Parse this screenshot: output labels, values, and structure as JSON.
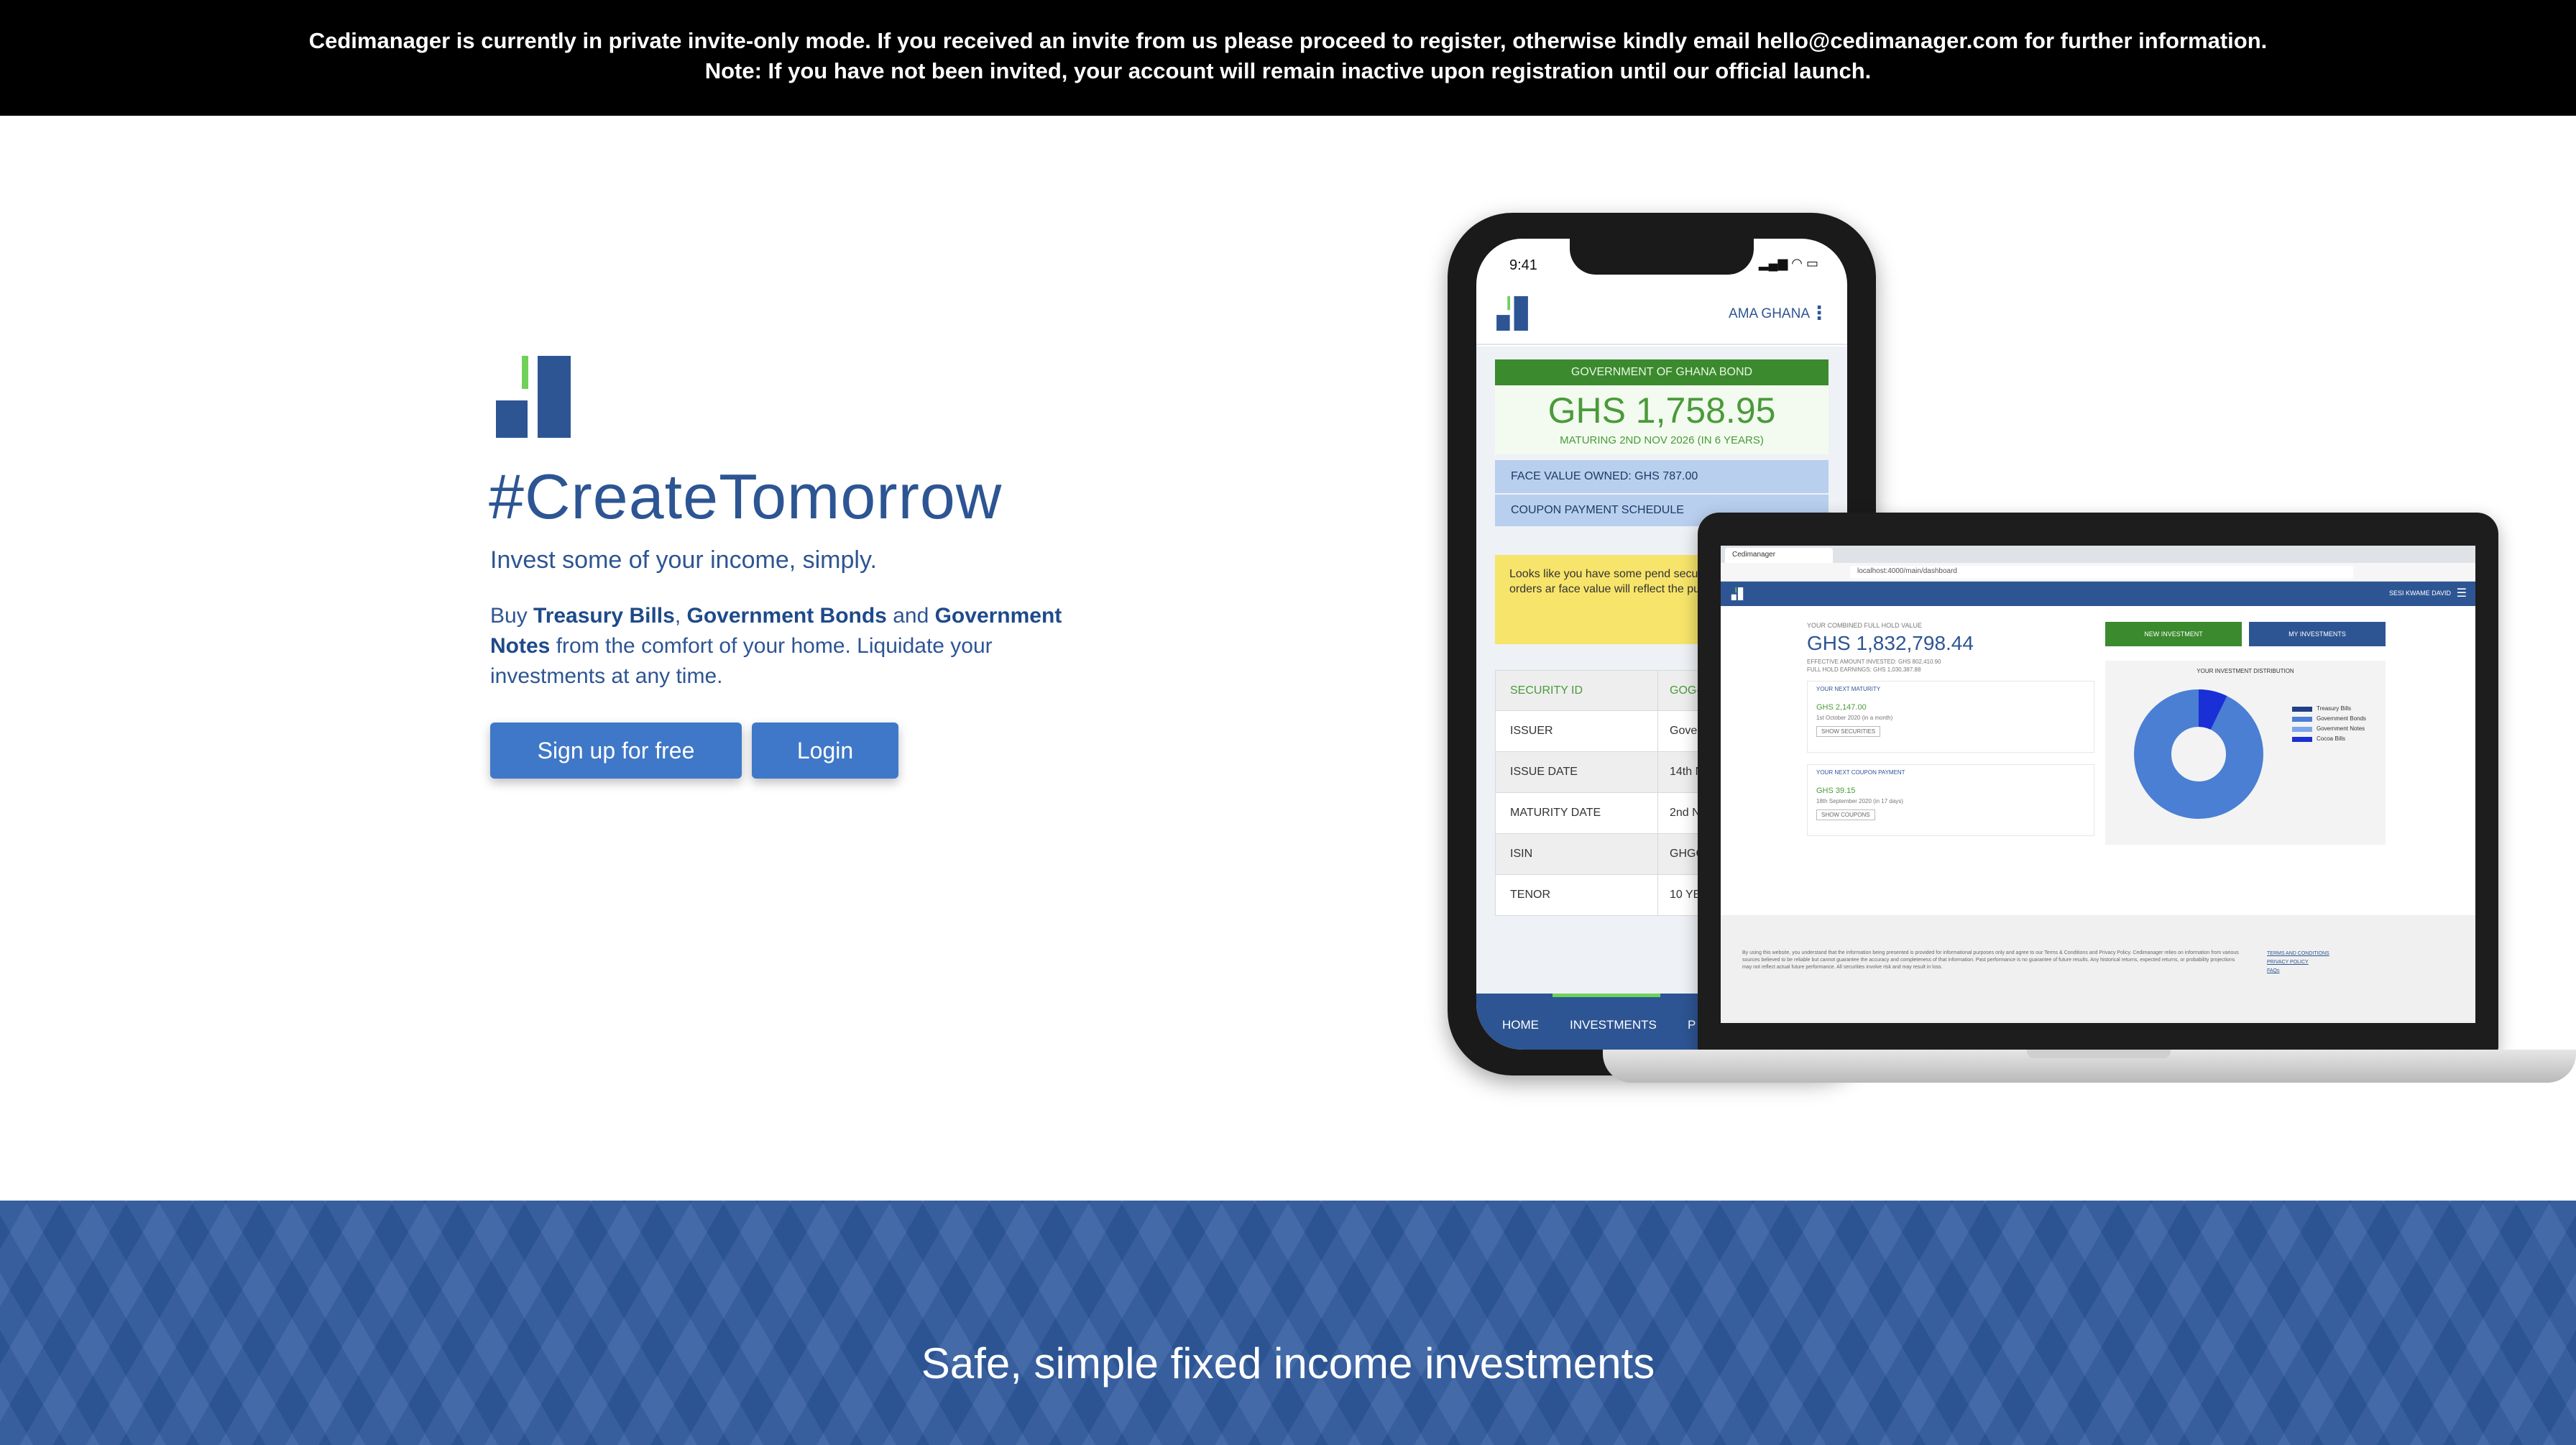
{
  "notice": {
    "line1": "Cedimanager is currently in private invite-only mode. If you received an invite from us please proceed to register, otherwise kindly email hello@cedimanager.com for further information.",
    "line2": "Note: If you have not been invited, your account will remain inactive upon registration until our official launch."
  },
  "hero": {
    "title": "#CreateTomorrow",
    "subtitle": "Invest some of your income, simply.",
    "desc_buy": "Buy ",
    "desc_tbills": "Treasury Bills",
    "desc_comma": ", ",
    "desc_gbonds": "Government Bonds",
    "desc_and": " and ",
    "desc_gnotes": "Government Notes",
    "desc_rest": " from the comfort of your home. Liquidate your investments at any time.",
    "signup_label": "Sign up for free",
    "login_label": "Login"
  },
  "phone": {
    "time": "9:41",
    "status": "▂▄▆ ◠ ▭",
    "user": "AMA GHANA",
    "menu": "⋮",
    "bond_title": "GOVERNMENT OF GHANA BOND",
    "bond_value": "GHS 1,758.95",
    "bond_maturing": "MATURING 2ND NOV 2026 (IN 6 YEARS)",
    "face_value": "FACE VALUE OWNED: GHS 787.00",
    "coupon_schedule": "COUPON PAYMENT SCHEDULE",
    "note": "Looks like you have some pend security. When those orders ar face value will reflect the purc liquidations.",
    "table": [
      {
        "label": "SECURITY ID",
        "value": "GOG-G"
      },
      {
        "label": "ISSUER",
        "value": "Govern"
      },
      {
        "label": "ISSUE DATE",
        "value": "14th N"
      },
      {
        "label": "MATURITY DATE",
        "value": "2nd N"
      },
      {
        "label": "ISIN",
        "value": "GHGG"
      },
      {
        "label": "TENOR",
        "value": "10 YEA"
      }
    ],
    "nav": {
      "home": "HOME",
      "investments": "INVESTMENTS",
      "p": "P"
    }
  },
  "laptop": {
    "tab_title": "Cedimanager",
    "url": "localhost:4000/main/dashboard",
    "user": "SESI KWAME DAVID",
    "combined_label": "YOUR COMBINED FULL HOLD VALUE",
    "combined_value": "GHS 1,832,798.44",
    "combined_meta1": "EFFECTIVE AMOUNT INVESTED: GHS 802,410.90",
    "combined_meta2": "FULL HOLD EARNINGS: GHS 1,030,387.88",
    "next_maturity": {
      "title": "YOUR NEXT MATURITY",
      "value": "GHS 2,147.00",
      "sub": "1st October 2020 (in a month)",
      "btn": "SHOW SECURITIES"
    },
    "next_coupon": {
      "title": "YOUR NEXT COUPON PAYMENT",
      "value": "GHS 39.15",
      "sub": "18th September 2020 (in 17 days)",
      "btn": "SHOW COUPONS"
    },
    "new_investment": "NEW INVESTMENT",
    "my_investments": "MY INVESTMENTS",
    "dist_title": "YOUR INVESTMENT DISTRIBUTION",
    "legend": [
      {
        "name": "Treasury Bills",
        "color": "#1f3f86"
      },
      {
        "name": "Government Bonds",
        "color": "#4a7fd4"
      },
      {
        "name": "Government Notes",
        "color": "#7aa6ea"
      },
      {
        "name": "Cocoa Bills",
        "color": "#1a2fd6"
      }
    ],
    "footer_text": "By using this website, you understand that the information being presented is provided for informational purposes only and agree to our Terms & Conditions and Privacy Policy. Cedimanager relies on information from various sources believed to be reliable but cannot guarantee the accuracy and completeness of that information. Past performance is no guarantee of future results. Any historical returns, expected returns, or probability projections may not reflect actual future performance. All securities involve risk and may result in loss.",
    "footer_links": [
      "TERMS AND CONDITIONS",
      "PRIVACY POLICY",
      "FAQs"
    ]
  },
  "section": {
    "title": "Safe, simple fixed income investments"
  },
  "colors": {
    "brand_blue": "#2d5593",
    "button_blue": "#3f78c8",
    "accent_green": "#6fd15a",
    "bond_green": "#3b8a2e"
  }
}
